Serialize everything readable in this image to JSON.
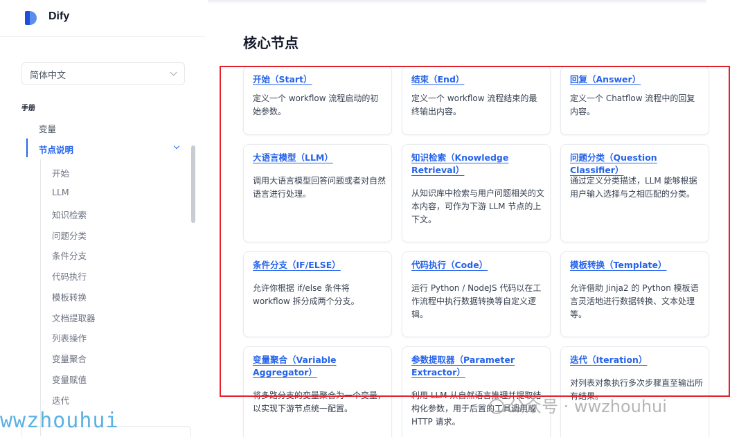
{
  "app": {
    "name": "Dify"
  },
  "sidebar": {
    "language": "简体中文",
    "section": "手册",
    "items": [
      {
        "label": "变量"
      },
      {
        "label": "节点说明"
      }
    ],
    "sub_items": [
      "开始",
      "LLM",
      "知识检索",
      "问题分类",
      "条件分支",
      "代码执行",
      "模板转换",
      "文档提取器",
      "列表操作",
      "变量聚合",
      "变量赋值",
      "迭代"
    ]
  },
  "main": {
    "title": "核心节点",
    "cards": [
      {
        "title": "开始（Start）",
        "desc": "定义一个 workflow 流程启动的初始参数。"
      },
      {
        "title": "结束（End）",
        "desc": "定义一个 workflow 流程结束的最终输出内容。"
      },
      {
        "title": "回复（Answer）",
        "desc": "定义一个 Chatflow 流程中的回复内容。"
      },
      {
        "title": "大语言模型（LLM）",
        "desc": "调用大语言模型回答问题或者对自然语言进行处理。"
      },
      {
        "title": "知识检索（Knowledge Retrieval）",
        "desc": "从知识库中检索与用户问题相关的文本内容，可作为下游 LLM 节点的上下文。"
      },
      {
        "title": "问题分类（Question Classifier）",
        "desc": "通过定义分类描述，LLM 能够根据用户输入选择与之相匹配的分类。"
      },
      {
        "title": "条件分支（IF/ELSE）",
        "desc": "允许你根据 if/else 条件将 workflow 拆分成两个分支。"
      },
      {
        "title": "代码执行（Code）",
        "desc": "运行 Python / NodeJS 代码以在工作流程中执行数据转换等自定义逻辑。"
      },
      {
        "title": "模板转换（Template）",
        "desc": "允许借助 Jinja2 的 Python 模板语言灵活地进行数据转换、文本处理等。"
      },
      {
        "title": "变量聚合（Variable Aggregator）",
        "desc": "将多路分支的变量聚合为一个变量，以实现下游节点统一配置。"
      },
      {
        "title": "参数提取器（Parameter Extractor）",
        "desc": "利用 LLM 从自然语言推理并提取结构化参数，用于后置的工具调用或 HTTP 请求。"
      },
      {
        "title": "迭代（Iteration）",
        "desc": "对列表对象执行多次步骤直至输出所有结果。"
      }
    ]
  },
  "watermarks": {
    "left": "wwzhouhui",
    "right": "公众号 · wwzhouhui"
  },
  "colors": {
    "accent": "#2563eb",
    "highlight": "#e3222b"
  }
}
